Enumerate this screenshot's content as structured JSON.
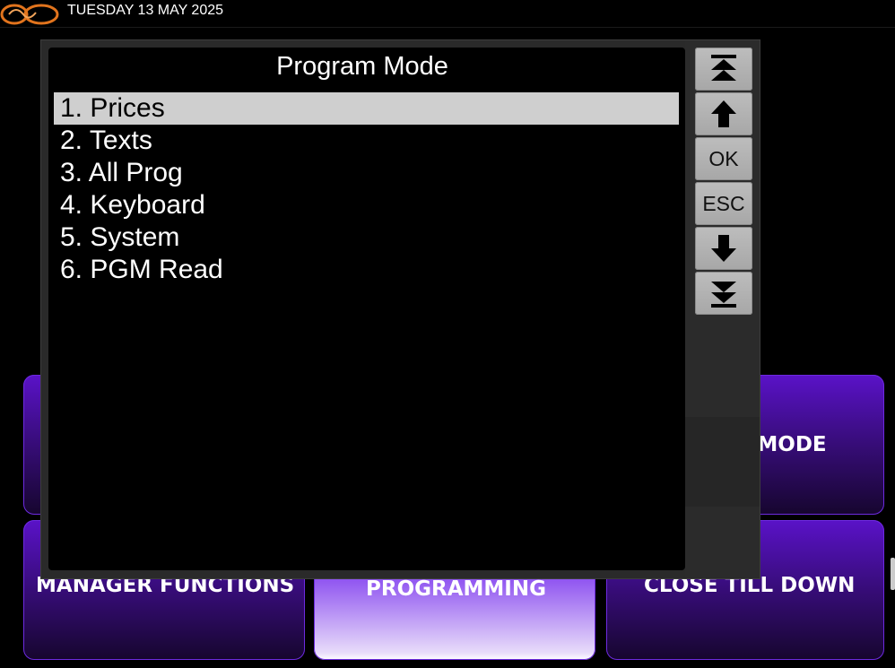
{
  "topbar": {
    "date": "TUESDAY 13 MAY 2025",
    "logo": "swirl-logo"
  },
  "dialog": {
    "title": "Program Mode",
    "items": [
      {
        "label": "1. Prices",
        "selected": true
      },
      {
        "label": "2. Texts"
      },
      {
        "label": "3. All Prog"
      },
      {
        "label": "4. Keyboard"
      },
      {
        "label": "5. System"
      },
      {
        "label": "6. PGM Read"
      }
    ],
    "buttons": {
      "page_up_icon": "double-up-arrow-icon",
      "up_icon": "up-arrow-icon",
      "ok": "OK",
      "esc": "ESC",
      "down_icon": "down-arrow-icon",
      "page_down_icon": "double-down-arrow-icon"
    }
  },
  "tiles": {
    "mode": "MODE",
    "manager": "MANAGER FUNCTIONS",
    "programming": "PROGRAMMING",
    "close_till": "CLOSE TILL DOWN"
  },
  "colors": {
    "tile_purple": "#5a12c8",
    "selected_row": "#cfcfcf",
    "button_gray": "#b3b3b3"
  }
}
